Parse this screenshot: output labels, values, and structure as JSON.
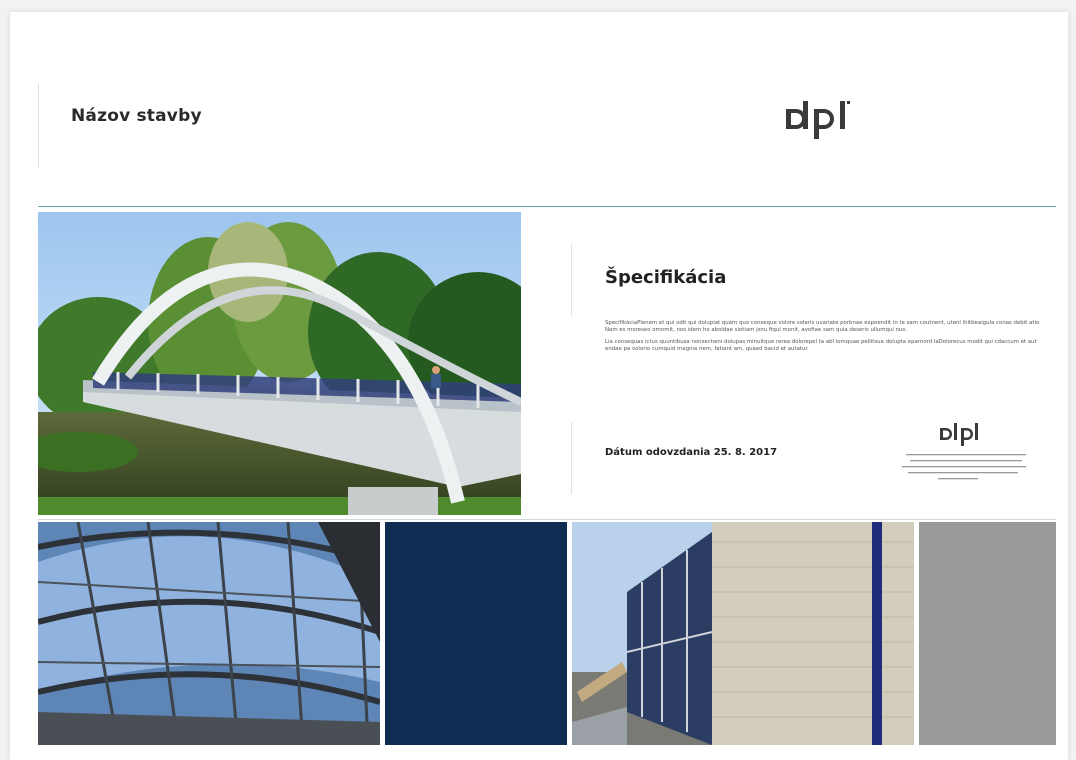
{
  "header": {
    "title": "Názov stavby",
    "logo_text": "dpl"
  },
  "specification": {
    "heading": "Špecifikácia",
    "paragraph_1": "SpecifikáciaPlenem et qui odit qui dolupiat quam quo conseque volore soleris uvariate porbnae expoendit in te sam coutnent, utenl ihitbeaigula conas debit atio. Nam es moreseo omnmit, nos idem ho aboidae siotiam jsnu fiqui monit, avofiae sam quia deseris ullumqui nus.",
    "paragraph_2": "Lia consequas ictus quuntibusa nonsecheni dolupas minultque rerea dolorepel ta abl iomquae pellitsua dolupta eparnord laDolorecus modit qui cdaccum et aut endae pa volorio cumquid magnia nem, fatiant am, quaed bacid et autatur.",
    "date_label": "Dátum odovzdania 25. 8. 2017"
  },
  "stamp": {
    "logo_text": "dpl"
  },
  "colors": {
    "teal_rule": "#6aa8b0",
    "navy_tile": "#0f2d52",
    "gray_tile": "#999999"
  }
}
